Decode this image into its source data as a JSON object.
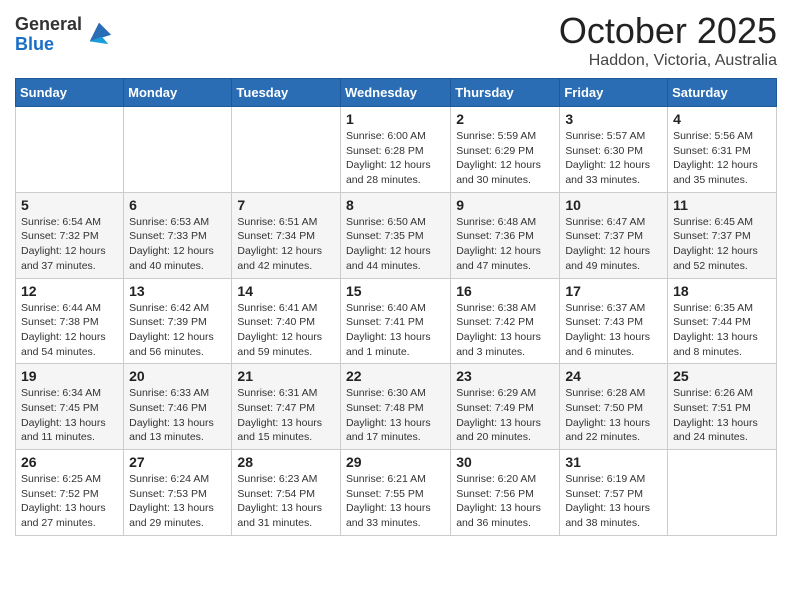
{
  "header": {
    "logo_general": "General",
    "logo_blue": "Blue",
    "month_title": "October 2025",
    "location": "Haddon, Victoria, Australia"
  },
  "days_of_week": [
    "Sunday",
    "Monday",
    "Tuesday",
    "Wednesday",
    "Thursday",
    "Friday",
    "Saturday"
  ],
  "weeks": [
    [
      {
        "num": "",
        "info": ""
      },
      {
        "num": "",
        "info": ""
      },
      {
        "num": "",
        "info": ""
      },
      {
        "num": "1",
        "info": "Sunrise: 6:00 AM\nSunset: 6:28 PM\nDaylight: 12 hours\nand 28 minutes."
      },
      {
        "num": "2",
        "info": "Sunrise: 5:59 AM\nSunset: 6:29 PM\nDaylight: 12 hours\nand 30 minutes."
      },
      {
        "num": "3",
        "info": "Sunrise: 5:57 AM\nSunset: 6:30 PM\nDaylight: 12 hours\nand 33 minutes."
      },
      {
        "num": "4",
        "info": "Sunrise: 5:56 AM\nSunset: 6:31 PM\nDaylight: 12 hours\nand 35 minutes."
      }
    ],
    [
      {
        "num": "5",
        "info": "Sunrise: 6:54 AM\nSunset: 7:32 PM\nDaylight: 12 hours\nand 37 minutes."
      },
      {
        "num": "6",
        "info": "Sunrise: 6:53 AM\nSunset: 7:33 PM\nDaylight: 12 hours\nand 40 minutes."
      },
      {
        "num": "7",
        "info": "Sunrise: 6:51 AM\nSunset: 7:34 PM\nDaylight: 12 hours\nand 42 minutes."
      },
      {
        "num": "8",
        "info": "Sunrise: 6:50 AM\nSunset: 7:35 PM\nDaylight: 12 hours\nand 44 minutes."
      },
      {
        "num": "9",
        "info": "Sunrise: 6:48 AM\nSunset: 7:36 PM\nDaylight: 12 hours\nand 47 minutes."
      },
      {
        "num": "10",
        "info": "Sunrise: 6:47 AM\nSunset: 7:37 PM\nDaylight: 12 hours\nand 49 minutes."
      },
      {
        "num": "11",
        "info": "Sunrise: 6:45 AM\nSunset: 7:37 PM\nDaylight: 12 hours\nand 52 minutes."
      }
    ],
    [
      {
        "num": "12",
        "info": "Sunrise: 6:44 AM\nSunset: 7:38 PM\nDaylight: 12 hours\nand 54 minutes."
      },
      {
        "num": "13",
        "info": "Sunrise: 6:42 AM\nSunset: 7:39 PM\nDaylight: 12 hours\nand 56 minutes."
      },
      {
        "num": "14",
        "info": "Sunrise: 6:41 AM\nSunset: 7:40 PM\nDaylight: 12 hours\nand 59 minutes."
      },
      {
        "num": "15",
        "info": "Sunrise: 6:40 AM\nSunset: 7:41 PM\nDaylight: 13 hours\nand 1 minute."
      },
      {
        "num": "16",
        "info": "Sunrise: 6:38 AM\nSunset: 7:42 PM\nDaylight: 13 hours\nand 3 minutes."
      },
      {
        "num": "17",
        "info": "Sunrise: 6:37 AM\nSunset: 7:43 PM\nDaylight: 13 hours\nand 6 minutes."
      },
      {
        "num": "18",
        "info": "Sunrise: 6:35 AM\nSunset: 7:44 PM\nDaylight: 13 hours\nand 8 minutes."
      }
    ],
    [
      {
        "num": "19",
        "info": "Sunrise: 6:34 AM\nSunset: 7:45 PM\nDaylight: 13 hours\nand 11 minutes."
      },
      {
        "num": "20",
        "info": "Sunrise: 6:33 AM\nSunset: 7:46 PM\nDaylight: 13 hours\nand 13 minutes."
      },
      {
        "num": "21",
        "info": "Sunrise: 6:31 AM\nSunset: 7:47 PM\nDaylight: 13 hours\nand 15 minutes."
      },
      {
        "num": "22",
        "info": "Sunrise: 6:30 AM\nSunset: 7:48 PM\nDaylight: 13 hours\nand 17 minutes."
      },
      {
        "num": "23",
        "info": "Sunrise: 6:29 AM\nSunset: 7:49 PM\nDaylight: 13 hours\nand 20 minutes."
      },
      {
        "num": "24",
        "info": "Sunrise: 6:28 AM\nSunset: 7:50 PM\nDaylight: 13 hours\nand 22 minutes."
      },
      {
        "num": "25",
        "info": "Sunrise: 6:26 AM\nSunset: 7:51 PM\nDaylight: 13 hours\nand 24 minutes."
      }
    ],
    [
      {
        "num": "26",
        "info": "Sunrise: 6:25 AM\nSunset: 7:52 PM\nDaylight: 13 hours\nand 27 minutes."
      },
      {
        "num": "27",
        "info": "Sunrise: 6:24 AM\nSunset: 7:53 PM\nDaylight: 13 hours\nand 29 minutes."
      },
      {
        "num": "28",
        "info": "Sunrise: 6:23 AM\nSunset: 7:54 PM\nDaylight: 13 hours\nand 31 minutes."
      },
      {
        "num": "29",
        "info": "Sunrise: 6:21 AM\nSunset: 7:55 PM\nDaylight: 13 hours\nand 33 minutes."
      },
      {
        "num": "30",
        "info": "Sunrise: 6:20 AM\nSunset: 7:56 PM\nDaylight: 13 hours\nand 36 minutes."
      },
      {
        "num": "31",
        "info": "Sunrise: 6:19 AM\nSunset: 7:57 PM\nDaylight: 13 hours\nand 38 minutes."
      },
      {
        "num": "",
        "info": ""
      }
    ]
  ]
}
